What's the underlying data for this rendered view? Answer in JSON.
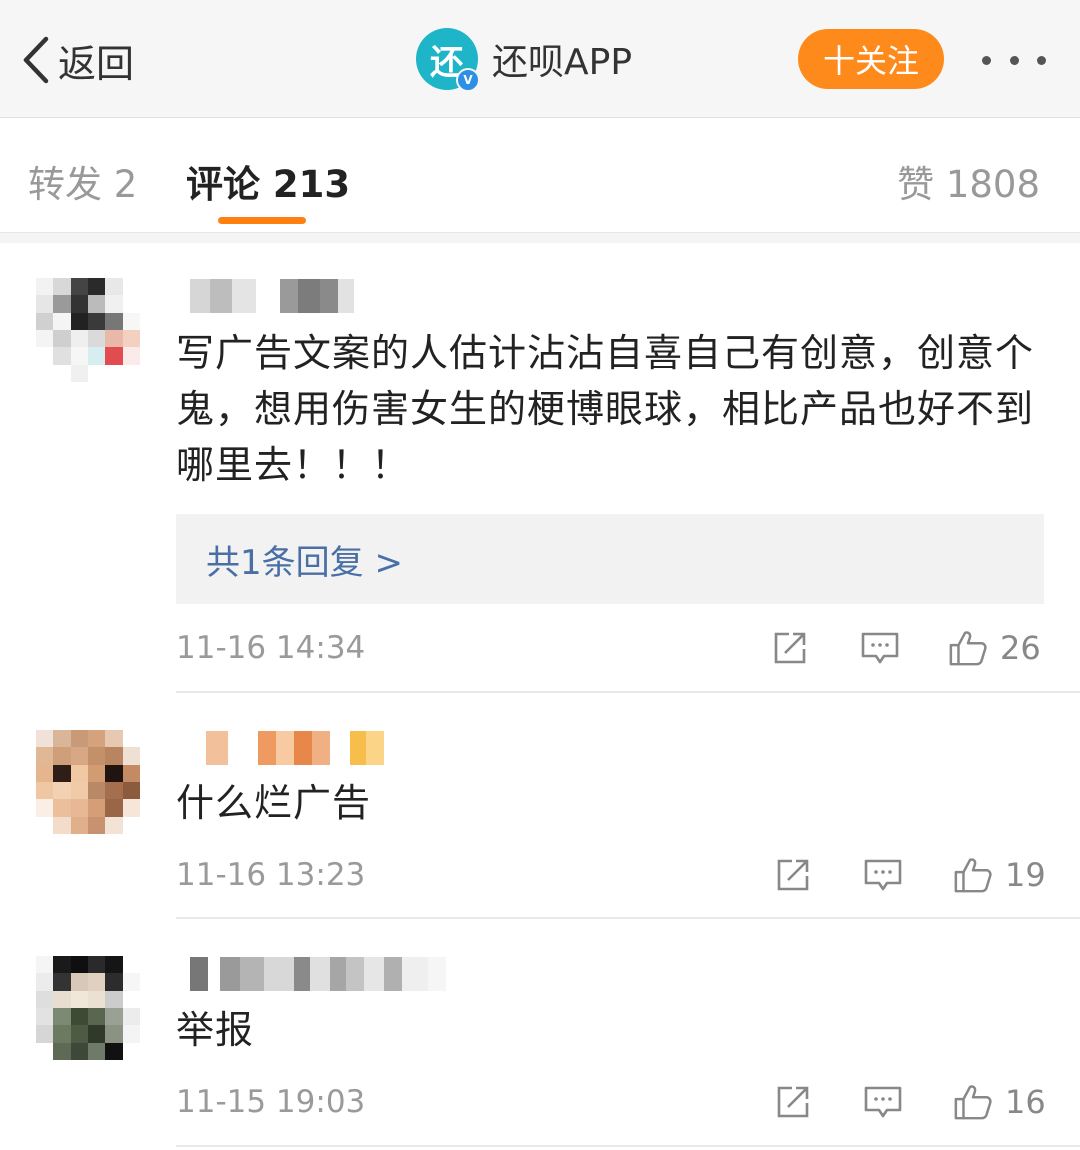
{
  "header": {
    "back_label": "返回",
    "account_logo_char": "还",
    "verified_mark": "V",
    "account_name": "还呗APP",
    "follow_label": "十关注"
  },
  "tabs": {
    "repost": "转发 2",
    "comments": "评论 213",
    "likes": "赞 1808"
  },
  "colors": {
    "accent": "#ff7f11",
    "follow_button": "#ff8a1c",
    "link": "#4a6fa5",
    "logo": "#1db5c7"
  },
  "comments": [
    {
      "text": "写广告文案的人估计沾沾自喜自己有创意，创意个鬼，想用伤害女生的梗博眼球，相比产品也好不到哪里去！！！",
      "replies_label": "共1条回复 >",
      "time": "11-16 14:34",
      "likes": "26"
    },
    {
      "text": "什么烂广告",
      "time": "11-16 13:23",
      "likes": "19"
    },
    {
      "text": "举报",
      "time": "11-15 19:03",
      "likes": "16"
    }
  ]
}
